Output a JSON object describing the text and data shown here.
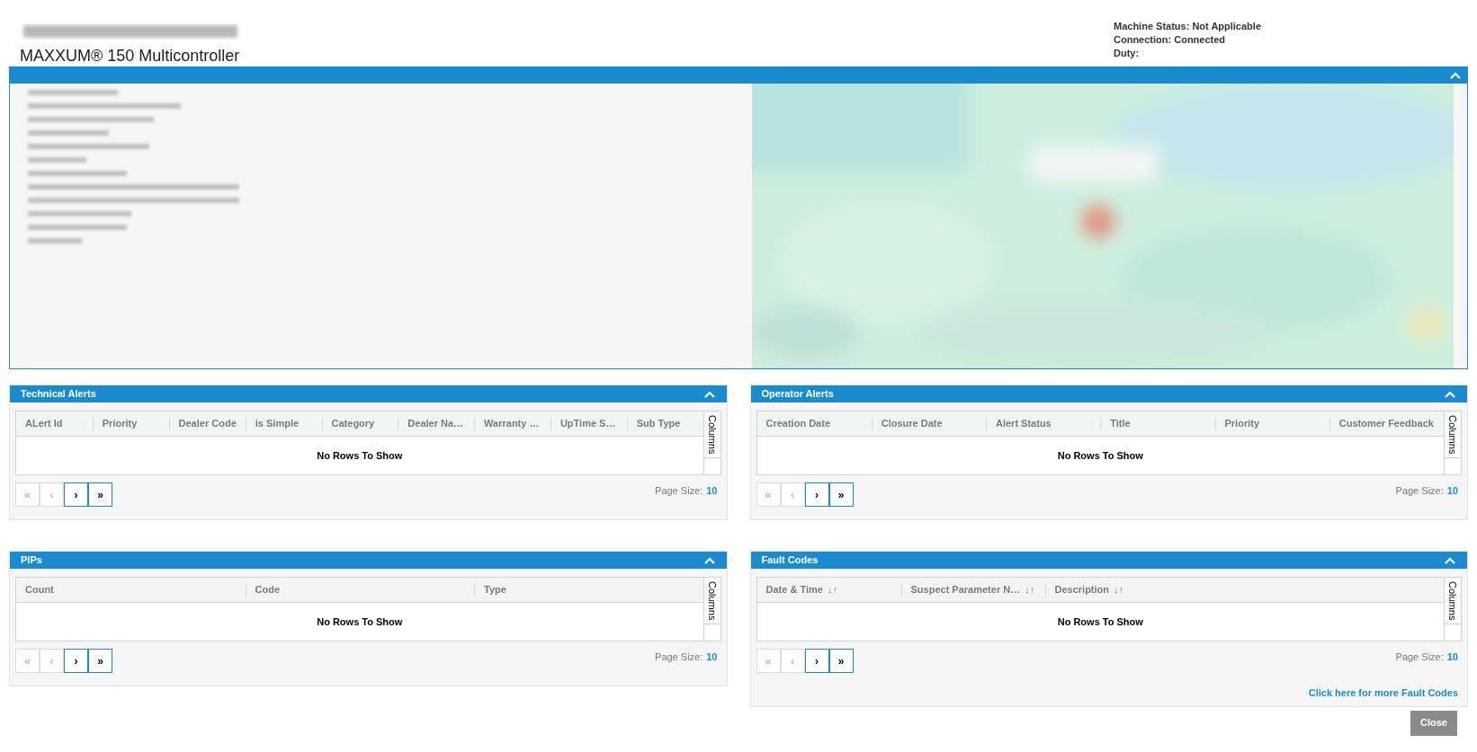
{
  "header": {
    "model": "MAXXUM® 150 Multicontroller",
    "status_lines": [
      "Machine Status: Not Applicable",
      "Connection: Connected",
      "Duty:"
    ]
  },
  "details_panel": {
    "expanded": true
  },
  "panels": [
    {
      "title": "Technical Alerts",
      "expanded": true,
      "columns": [
        {
          "label": "ALert Id"
        },
        {
          "label": "Priority"
        },
        {
          "label": "Dealer Code"
        },
        {
          "label": "is Simple"
        },
        {
          "label": "Category"
        },
        {
          "label": "Dealer Na…"
        },
        {
          "label": "Warranty …"
        },
        {
          "label": "UpTime S…"
        },
        {
          "label": "Sub Type"
        }
      ],
      "empty_text": "No Rows To Show",
      "columns_tab": "Columns",
      "pager": [
        {
          "label": "«",
          "disabled": true
        },
        {
          "label": "‹",
          "disabled": true
        },
        {
          "label": "›",
          "disabled": false
        },
        {
          "label": "»",
          "disabled": false
        }
      ],
      "page_size_label": "Page Size:",
      "page_size": "10"
    },
    {
      "title": "Operator Alerts",
      "expanded": true,
      "columns": [
        {
          "label": "Creation Date"
        },
        {
          "label": "Closure Date"
        },
        {
          "label": "Alert Status"
        },
        {
          "label": "Title"
        },
        {
          "label": "Priority"
        },
        {
          "label": "Customer Feedback"
        }
      ],
      "empty_text": "No Rows To Show",
      "columns_tab": "Columns",
      "pager": [
        {
          "label": "«",
          "disabled": true
        },
        {
          "label": "‹",
          "disabled": true
        },
        {
          "label": "›",
          "disabled": false
        },
        {
          "label": "»",
          "disabled": false
        }
      ],
      "page_size_label": "Page Size:",
      "page_size": "10"
    },
    {
      "title": "PIPs",
      "expanded": true,
      "columns": [
        {
          "label": "Count"
        },
        {
          "label": "Code"
        },
        {
          "label": "Type"
        }
      ],
      "empty_text": "No Rows To Show",
      "columns_tab": "Columns",
      "pager": [
        {
          "label": "«",
          "disabled": true
        },
        {
          "label": "‹",
          "disabled": true
        },
        {
          "label": "›",
          "disabled": false
        },
        {
          "label": "»",
          "disabled": false
        }
      ],
      "page_size_label": "Page Size:",
      "page_size": "10"
    },
    {
      "title": "Fault Codes",
      "expanded": true,
      "columns": [
        {
          "label": "Date & Time",
          "sort": "↓↑"
        },
        {
          "label": "Suspect Parameter N…",
          "sort": "↓↑"
        },
        {
          "label": "Description",
          "sort": "↓↑"
        }
      ],
      "empty_text": "No Rows To Show",
      "columns_tab": "Columns",
      "pager": [
        {
          "label": "«",
          "disabled": true
        },
        {
          "label": "‹",
          "disabled": true
        },
        {
          "label": "›",
          "disabled": false
        },
        {
          "label": "»",
          "disabled": false
        }
      ],
      "page_size_label": "Page Size:",
      "page_size": "10",
      "more_link": "Click here for more Fault Codes"
    }
  ],
  "close_button": "Close"
}
